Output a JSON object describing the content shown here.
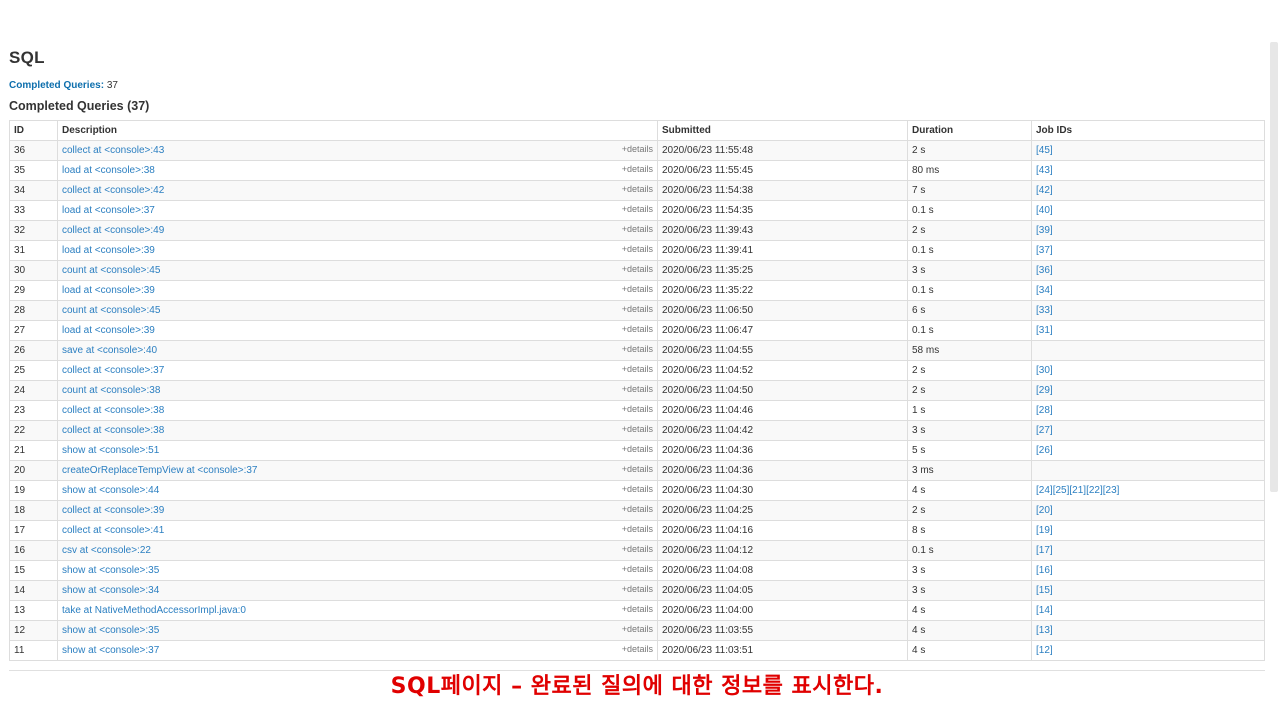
{
  "page": {
    "title": "SQL",
    "summary_label": "Completed Queries:",
    "summary_count": "37",
    "section_heading": "Completed Queries (37)"
  },
  "table": {
    "headers": {
      "id": "ID",
      "description": "Description",
      "submitted": "Submitted",
      "duration": "Duration",
      "job_ids": "Job IDs"
    },
    "details_label": "+details",
    "rows": [
      {
        "id": "36",
        "description": "collect at <console>:43",
        "submitted": "2020/06/23 11:55:48",
        "duration": "2 s",
        "jobs": [
          "45"
        ]
      },
      {
        "id": "35",
        "description": "load at <console>:38",
        "submitted": "2020/06/23 11:55:45",
        "duration": "80 ms",
        "jobs": [
          "43"
        ]
      },
      {
        "id": "34",
        "description": "collect at <console>:42",
        "submitted": "2020/06/23 11:54:38",
        "duration": "7 s",
        "jobs": [
          "42"
        ]
      },
      {
        "id": "33",
        "description": "load at <console>:37",
        "submitted": "2020/06/23 11:54:35",
        "duration": "0.1 s",
        "jobs": [
          "40"
        ]
      },
      {
        "id": "32",
        "description": "collect at <console>:49",
        "submitted": "2020/06/23 11:39:43",
        "duration": "2 s",
        "jobs": [
          "39"
        ]
      },
      {
        "id": "31",
        "description": "load at <console>:39",
        "submitted": "2020/06/23 11:39:41",
        "duration": "0.1 s",
        "jobs": [
          "37"
        ]
      },
      {
        "id": "30",
        "description": "count at <console>:45",
        "submitted": "2020/06/23 11:35:25",
        "duration": "3 s",
        "jobs": [
          "36"
        ]
      },
      {
        "id": "29",
        "description": "load at <console>:39",
        "submitted": "2020/06/23 11:35:22",
        "duration": "0.1 s",
        "jobs": [
          "34"
        ]
      },
      {
        "id": "28",
        "description": "count at <console>:45",
        "submitted": "2020/06/23 11:06:50",
        "duration": "6 s",
        "jobs": [
          "33"
        ]
      },
      {
        "id": "27",
        "description": "load at <console>:39",
        "submitted": "2020/06/23 11:06:47",
        "duration": "0.1 s",
        "jobs": [
          "31"
        ]
      },
      {
        "id": "26",
        "description": "save at <console>:40",
        "submitted": "2020/06/23 11:04:55",
        "duration": "58 ms",
        "jobs": []
      },
      {
        "id": "25",
        "description": "collect at <console>:37",
        "submitted": "2020/06/23 11:04:52",
        "duration": "2 s",
        "jobs": [
          "30"
        ]
      },
      {
        "id": "24",
        "description": "count at <console>:38",
        "submitted": "2020/06/23 11:04:50",
        "duration": "2 s",
        "jobs": [
          "29"
        ]
      },
      {
        "id": "23",
        "description": "collect at <console>:38",
        "submitted": "2020/06/23 11:04:46",
        "duration": "1 s",
        "jobs": [
          "28"
        ]
      },
      {
        "id": "22",
        "description": "collect at <console>:38",
        "submitted": "2020/06/23 11:04:42",
        "duration": "3 s",
        "jobs": [
          "27"
        ]
      },
      {
        "id": "21",
        "description": "show at <console>:51",
        "submitted": "2020/06/23 11:04:36",
        "duration": "5 s",
        "jobs": [
          "26"
        ]
      },
      {
        "id": "20",
        "description": "createOrReplaceTempView at <console>:37",
        "submitted": "2020/06/23 11:04:36",
        "duration": "3 ms",
        "jobs": []
      },
      {
        "id": "19",
        "description": "show at <console>:44",
        "submitted": "2020/06/23 11:04:30",
        "duration": "4 s",
        "jobs": [
          "24",
          "25",
          "21",
          "22",
          "23"
        ]
      },
      {
        "id": "18",
        "description": "collect at <console>:39",
        "submitted": "2020/06/23 11:04:25",
        "duration": "2 s",
        "jobs": [
          "20"
        ]
      },
      {
        "id": "17",
        "description": "collect at <console>:41",
        "submitted": "2020/06/23 11:04:16",
        "duration": "8 s",
        "jobs": [
          "19"
        ]
      },
      {
        "id": "16",
        "description": "csv at <console>:22",
        "submitted": "2020/06/23 11:04:12",
        "duration": "0.1 s",
        "jobs": [
          "17"
        ]
      },
      {
        "id": "15",
        "description": "show at <console>:35",
        "submitted": "2020/06/23 11:04:08",
        "duration": "3 s",
        "jobs": [
          "16"
        ]
      },
      {
        "id": "14",
        "description": "show at <console>:34",
        "submitted": "2020/06/23 11:04:05",
        "duration": "3 s",
        "jobs": [
          "15"
        ]
      },
      {
        "id": "13",
        "description": "take at NativeMethodAccessorImpl.java:0",
        "submitted": "2020/06/23 11:04:00",
        "duration": "4 s",
        "jobs": [
          "14"
        ]
      },
      {
        "id": "12",
        "description": "show at <console>:35",
        "submitted": "2020/06/23 11:03:55",
        "duration": "4 s",
        "jobs": [
          "13"
        ]
      },
      {
        "id": "11",
        "description": "show at <console>:37",
        "submitted": "2020/06/23 11:03:51",
        "duration": "4 s",
        "jobs": [
          "12"
        ]
      }
    ]
  },
  "caption": "SQL페이지 – 완료된 질의에 대한 정보를 표시한다.",
  "colors": {
    "link": "#2b7fc1",
    "caption": "#e00000",
    "row_stripe": "#f9f9f9"
  }
}
